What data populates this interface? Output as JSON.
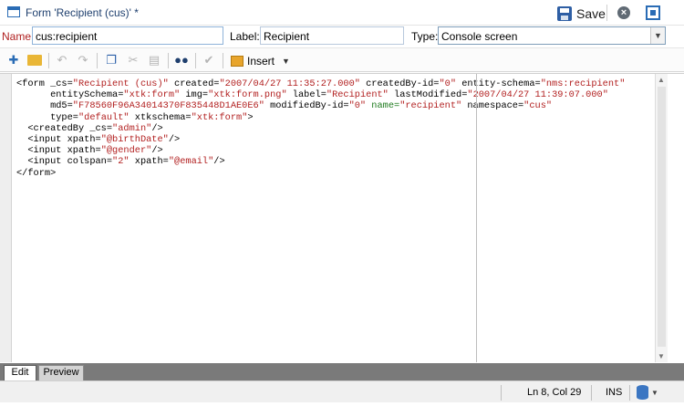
{
  "titlebar": {
    "title": "Form 'Recipient (cus)' *",
    "save_label": "Save"
  },
  "fields": {
    "name_label": "Name:",
    "name_value": "cus:recipient",
    "label_label": "Label:",
    "label_value": "Recipient",
    "type_label": "Type:",
    "type_value": "Console screen"
  },
  "toolbar": {
    "insert_label": "Insert"
  },
  "editor": {
    "lines": [
      [
        {
          "t": "<form _cs="
        },
        {
          "t": "\"Recipient (cus)\"",
          "c": "v"
        },
        {
          "t": " created="
        },
        {
          "t": "\"2007/04/27 11:35:27.000\"",
          "c": "v"
        },
        {
          "t": " createdBy-id="
        },
        {
          "t": "\"0\"",
          "c": "v"
        },
        {
          "t": " entity-schema="
        },
        {
          "t": "\"nms:recipient\"",
          "c": "v"
        }
      ],
      [
        {
          "t": "      entitySchema="
        },
        {
          "t": "\"xtk:form\"",
          "c": "v"
        },
        {
          "t": " img="
        },
        {
          "t": "\"xtk:form.png\"",
          "c": "v"
        },
        {
          "t": " label="
        },
        {
          "t": "\"Recipient\"",
          "c": "v"
        },
        {
          "t": " lastModified="
        },
        {
          "t": "\"2007/04/27 11:39:07.000\"",
          "c": "v"
        }
      ],
      [
        {
          "t": "      md5="
        },
        {
          "t": "\"F78560F96A34014370F835448D1AE0E6\"",
          "c": "v"
        },
        {
          "t": " modifiedBy-id="
        },
        {
          "t": "\"0\"",
          "c": "v"
        },
        {
          "t": " name=",
          "c": "g"
        },
        {
          "t": "\"recipient\"",
          "c": "v"
        },
        {
          "t": " namespace="
        },
        {
          "t": "\"cus\"",
          "c": "v"
        }
      ],
      [
        {
          "t": "      type="
        },
        {
          "t": "\"default\"",
          "c": "v"
        },
        {
          "t": " xtkschema="
        },
        {
          "t": "\"xtk:form\"",
          "c": "v"
        },
        {
          "t": ">"
        }
      ],
      [
        {
          "t": "  <createdBy _cs="
        },
        {
          "t": "\"admin\"",
          "c": "v"
        },
        {
          "t": "/>"
        }
      ],
      [
        {
          "t": "  <input xpath="
        },
        {
          "t": "\"@birthDate\"",
          "c": "v"
        },
        {
          "t": "/>"
        }
      ],
      [
        {
          "t": "  <input xpath="
        },
        {
          "t": "\"@gender\"",
          "c": "v"
        },
        {
          "t": "/>"
        }
      ],
      [
        {
          "t": "  <input colspan="
        },
        {
          "t": "\"2\"",
          "c": "v"
        },
        {
          "t": " xpath="
        },
        {
          "t": "\"@email\"",
          "c": "v"
        },
        {
          "t": "/>"
        }
      ],
      [
        {
          "t": "</form>"
        }
      ]
    ]
  },
  "tabs": [
    {
      "label": "Edit",
      "active": true
    },
    {
      "label": "Preview",
      "active": false
    }
  ],
  "status": {
    "cursor": "Ln 8, Col 29",
    "mode": "INS"
  },
  "colors": {
    "attr_value": "#b22020",
    "name_attr": "#1d7a1d",
    "accent": "#2a6cb5"
  }
}
